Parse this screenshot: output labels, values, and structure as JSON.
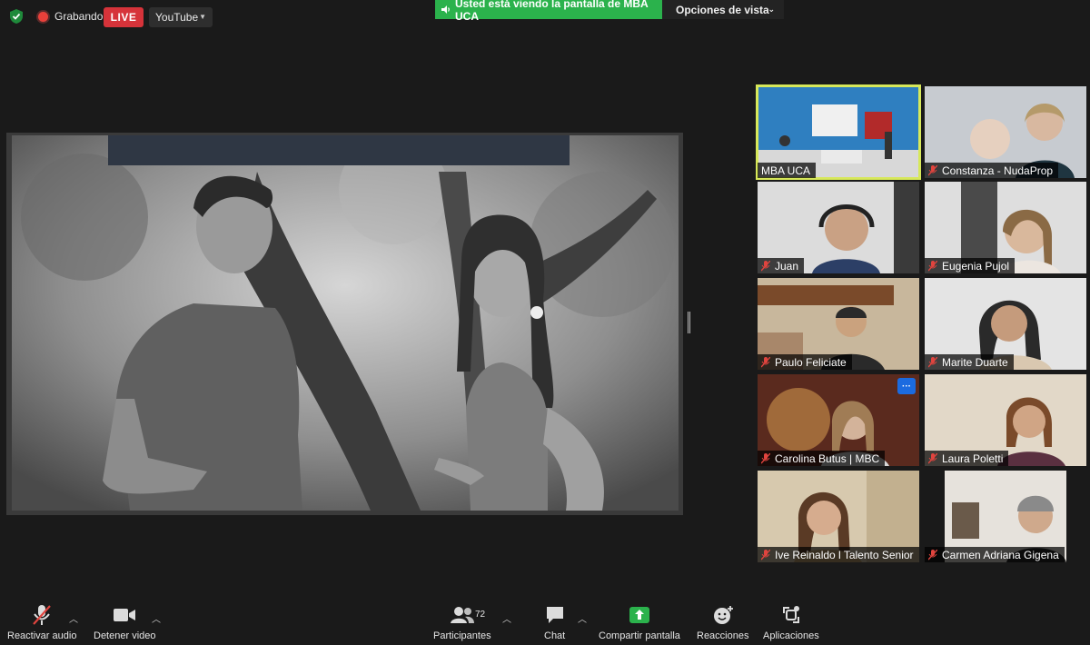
{
  "top_bar": {
    "recording_label": "Grabando",
    "live_label": "LIVE",
    "stream_target": "YouTube",
    "viewing_banner": "Usted está viendo la pantalla de MBA UCA",
    "view_options": "Opciones de vista"
  },
  "participants": [
    {
      "name": "MBA UCA",
      "muted": false,
      "active_speaker": true
    },
    {
      "name": "Constanza - NudaProp",
      "muted": true
    },
    {
      "name": "Juan",
      "muted": true
    },
    {
      "name": "Eugenia Pujol",
      "muted": true
    },
    {
      "name": "Paulo Feliciate",
      "muted": true
    },
    {
      "name": "Marite Duarte",
      "muted": true
    },
    {
      "name": "Carolina Butus | MBC",
      "muted": true,
      "more_button": "···"
    },
    {
      "name": "Laura Poletti",
      "muted": true
    },
    {
      "name": "Ive Reinaldo l Talento Senior",
      "muted": true
    },
    {
      "name": "Carmen Adriana Gigena",
      "muted": true
    }
  ],
  "toolbar": {
    "unmute": "Reactivar audio",
    "stop_video": "Detener video",
    "participants": "Participantes",
    "participant_count": "72",
    "chat": "Chat",
    "share": "Compartir pantalla",
    "reactions": "Reacciones",
    "apps": "Aplicaciones"
  },
  "colors": {
    "background": "#1a1a1a",
    "live_red": "#d6333a",
    "banner_green": "#2bb24c",
    "speaker_highlight": "#d7e85a",
    "share_green": "#2bb24c",
    "muted_red": "#e0443e"
  },
  "icons": [
    "shield-icon",
    "record-icon",
    "speaker-icon",
    "mic-muted-icon",
    "video-camera-icon",
    "participants-icon",
    "chat-icon",
    "share-screen-icon",
    "reactions-icon",
    "apps-icon"
  ]
}
